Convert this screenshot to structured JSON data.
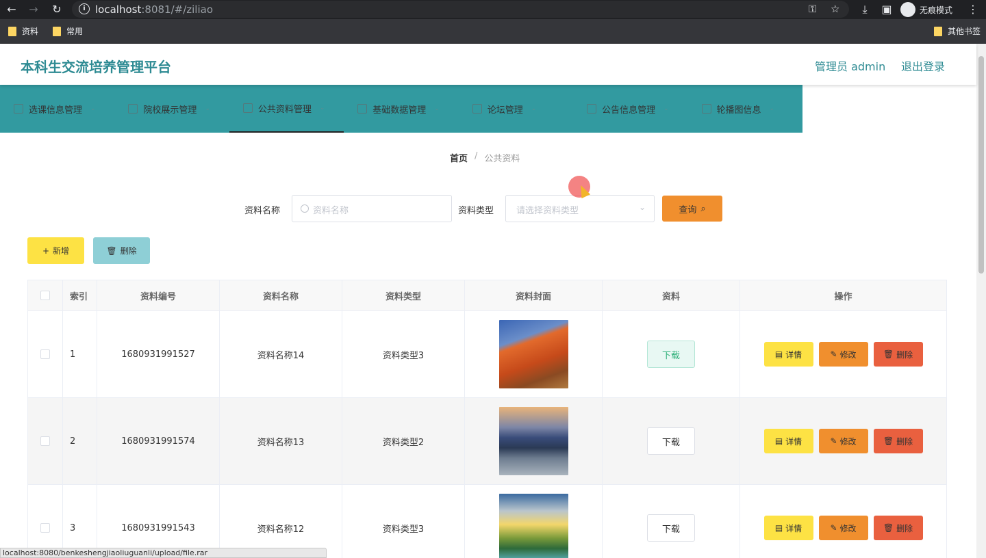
{
  "browser": {
    "url_host": "localhost",
    "url_rest": ":8081/#/ziliao",
    "incognito_label": "无痕模式",
    "bookmarks": [
      "资料",
      "常用"
    ],
    "other_bookmarks": "其他书签",
    "status_url": "localhost:8080/benkeshengjiaoliuguanli/upload/file.rar"
  },
  "header": {
    "title": "本科生交流培养管理平台",
    "admin_label": "管理员 admin",
    "logout_label": "退出登录"
  },
  "nav": {
    "items": [
      {
        "label": "选课信息管理",
        "icon": "edit-icon"
      },
      {
        "label": "院校展示管理",
        "icon": "briefcase-icon"
      },
      {
        "label": "公共资料管理",
        "icon": "list-icon"
      },
      {
        "label": "基础数据管理",
        "icon": "microphone-icon"
      },
      {
        "label": "论坛管理",
        "icon": "mail-icon"
      },
      {
        "label": "公告信息管理",
        "icon": "phone-icon"
      },
      {
        "label": "轮播图信息",
        "icon": "clipboard-icon"
      }
    ],
    "active_index": 2
  },
  "breadcrumb": {
    "home": "首页",
    "separator": "/",
    "current": "公共资料"
  },
  "search": {
    "name_label": "资料名称",
    "name_placeholder": "资料名称",
    "type_label": "资料类型",
    "type_placeholder": "请选择资料类型",
    "query_button": "查询"
  },
  "actions": {
    "add_button": "新增",
    "delete_button": "删除"
  },
  "table": {
    "headers": [
      "索引",
      "资料编号",
      "资料名称",
      "资料类型",
      "资料封面",
      "资料",
      "操作"
    ],
    "rows": [
      {
        "index": "1",
        "code": "1680931991527",
        "name": "资料名称14",
        "type": "资料类型3",
        "download": "下载",
        "detail": "详情",
        "edit": "修改",
        "remove": "删除"
      },
      {
        "index": "2",
        "code": "1680931991574",
        "name": "资料名称13",
        "type": "资料类型2",
        "download": "下载",
        "detail": "详情",
        "edit": "修改",
        "remove": "删除"
      },
      {
        "index": "3",
        "code": "1680931991543",
        "name": "资料名称12",
        "type": "资料类型3",
        "download": "下载",
        "detail": "详情",
        "edit": "修改",
        "remove": "删除"
      }
    ]
  },
  "colors": {
    "brand": "#2e8b93",
    "nav_bg": "#329aa0",
    "yellow": "#fde244",
    "orange": "#f08f2e",
    "red": "#e9603f"
  }
}
